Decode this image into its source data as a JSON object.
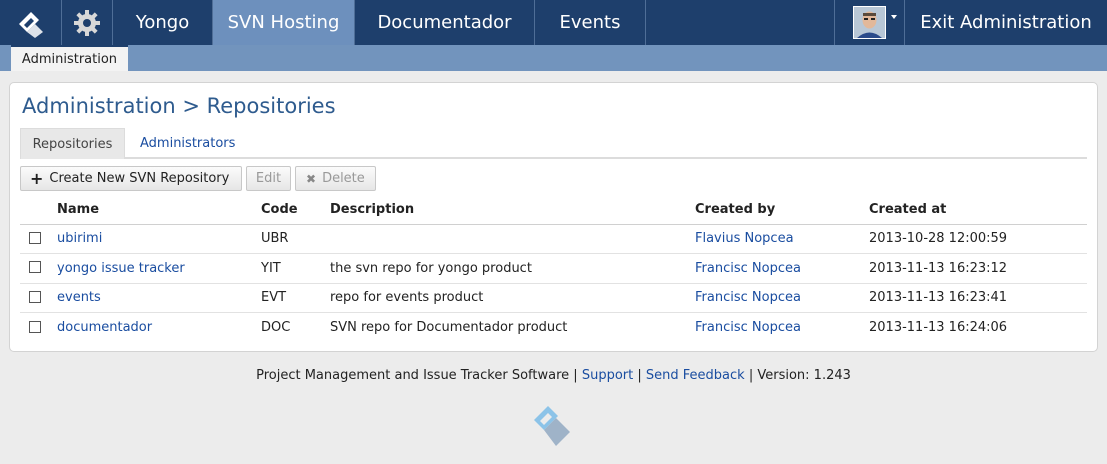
{
  "topnav": {
    "items": [
      {
        "label": "Yongo"
      },
      {
        "label": "SVN Hosting"
      },
      {
        "label": "Documentador"
      },
      {
        "label": "Events"
      }
    ],
    "exit_label": "Exit Administration"
  },
  "subnav": {
    "active": "Administration"
  },
  "page": {
    "title": "Administration > Repositories"
  },
  "tabs": [
    {
      "label": "Repositories"
    },
    {
      "label": "Administrators"
    }
  ],
  "toolbar": {
    "create_label": "Create New SVN Repository",
    "edit_label": "Edit",
    "delete_label": "Delete"
  },
  "table": {
    "headers": [
      "Name",
      "Code",
      "Description",
      "Created by",
      "Created at"
    ],
    "rows": [
      {
        "name": "ubirimi",
        "code": "UBR",
        "description": "",
        "created_by": "Flavius Nopcea",
        "created_at": "2013-10-28 12:00:59"
      },
      {
        "name": "yongo issue tracker",
        "code": "YIT",
        "description": "the svn repo for yongo product",
        "created_by": "Francisc Nopcea",
        "created_at": "2013-11-13 16:23:12"
      },
      {
        "name": "events",
        "code": "EVT",
        "description": "repo for events product",
        "created_by": "Francisc Nopcea",
        "created_at": "2013-11-13 16:23:41"
      },
      {
        "name": "documentador",
        "code": "DOC",
        "description": "SVN repo for Documentador product",
        "created_by": "Francisc Nopcea",
        "created_at": "2013-11-13 16:24:06"
      }
    ]
  },
  "footer": {
    "text": "Project Management and Issue Tracker Software",
    "sep": "|",
    "support": "Support",
    "feedback": "Send Feedback",
    "version": "Version: 1.243"
  },
  "colors": {
    "topbar": "#1e3f6c",
    "active_tab": "#6d90bd",
    "subbar": "#7294bd",
    "link": "#1a4da0",
    "title": "#2e5b8e"
  },
  "icons": [
    "app-logo-icon",
    "gear-icon",
    "avatar",
    "caret-down-icon",
    "plus-icon",
    "close-icon",
    "footer-logo-icon"
  ]
}
